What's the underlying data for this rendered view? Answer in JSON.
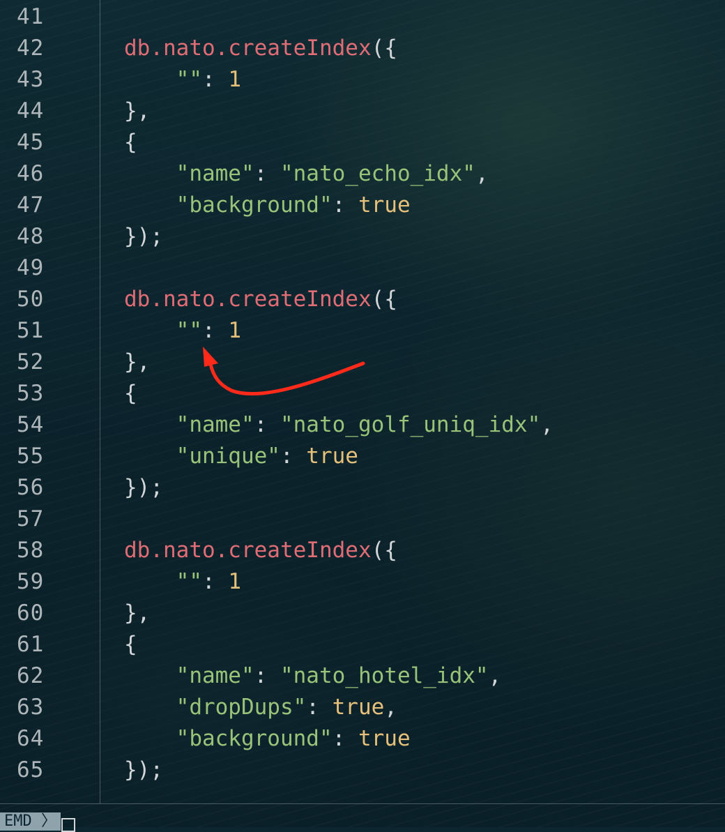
{
  "editor": {
    "lines": [
      {
        "number": "41",
        "indent": "",
        "tokens": []
      },
      {
        "number": "42",
        "indent": "",
        "tokens": [
          {
            "t": "db.nato.createIndex",
            "k": "fn"
          },
          {
            "t": "({",
            "k": "punc"
          }
        ]
      },
      {
        "number": "43",
        "indent": "    ",
        "tokens": [
          {
            "t": "\"\"",
            "k": "str"
          },
          {
            "t": ": ",
            "k": "punc"
          },
          {
            "t": "1",
            "k": "num"
          }
        ]
      },
      {
        "number": "44",
        "indent": "",
        "tokens": [
          {
            "t": "},",
            "k": "punc"
          }
        ]
      },
      {
        "number": "45",
        "indent": "",
        "tokens": [
          {
            "t": "{",
            "k": "punc"
          }
        ]
      },
      {
        "number": "46",
        "indent": "    ",
        "tokens": [
          {
            "t": "\"name\"",
            "k": "str"
          },
          {
            "t": ": ",
            "k": "punc"
          },
          {
            "t": "\"nato_echo_idx\"",
            "k": "str"
          },
          {
            "t": ",",
            "k": "punc"
          }
        ]
      },
      {
        "number": "47",
        "indent": "    ",
        "tokens": [
          {
            "t": "\"background\"",
            "k": "str"
          },
          {
            "t": ": ",
            "k": "punc"
          },
          {
            "t": "true",
            "k": "bool"
          }
        ]
      },
      {
        "number": "48",
        "indent": "",
        "tokens": [
          {
            "t": "});",
            "k": "punc"
          }
        ]
      },
      {
        "number": "49",
        "indent": "",
        "tokens": []
      },
      {
        "number": "50",
        "indent": "",
        "tokens": [
          {
            "t": "db.nato.createIndex",
            "k": "fn"
          },
          {
            "t": "({",
            "k": "punc"
          }
        ]
      },
      {
        "number": "51",
        "indent": "    ",
        "tokens": [
          {
            "t": "\"\"",
            "k": "str"
          },
          {
            "t": ": ",
            "k": "punc"
          },
          {
            "t": "1",
            "k": "num"
          }
        ]
      },
      {
        "number": "52",
        "indent": "",
        "tokens": [
          {
            "t": "},",
            "k": "punc"
          }
        ]
      },
      {
        "number": "53",
        "indent": "",
        "tokens": [
          {
            "t": "{",
            "k": "punc"
          }
        ]
      },
      {
        "number": "54",
        "indent": "    ",
        "tokens": [
          {
            "t": "\"name\"",
            "k": "str"
          },
          {
            "t": ": ",
            "k": "punc"
          },
          {
            "t": "\"nato_golf_uniq_idx\"",
            "k": "str"
          },
          {
            "t": ",",
            "k": "punc"
          }
        ]
      },
      {
        "number": "55",
        "indent": "    ",
        "tokens": [
          {
            "t": "\"unique\"",
            "k": "str"
          },
          {
            "t": ": ",
            "k": "punc"
          },
          {
            "t": "true",
            "k": "bool"
          }
        ]
      },
      {
        "number": "56",
        "indent": "",
        "tokens": [
          {
            "t": "});",
            "k": "punc"
          }
        ]
      },
      {
        "number": "57",
        "indent": "",
        "tokens": []
      },
      {
        "number": "58",
        "indent": "",
        "tokens": [
          {
            "t": "db.nato.createIndex",
            "k": "fn"
          },
          {
            "t": "({",
            "k": "punc"
          }
        ]
      },
      {
        "number": "59",
        "indent": "    ",
        "tokens": [
          {
            "t": "\"\"",
            "k": "str"
          },
          {
            "t": ": ",
            "k": "punc"
          },
          {
            "t": "1",
            "k": "num"
          }
        ]
      },
      {
        "number": "60",
        "indent": "",
        "tokens": [
          {
            "t": "},",
            "k": "punc"
          }
        ]
      },
      {
        "number": "61",
        "indent": "",
        "tokens": [
          {
            "t": "{",
            "k": "punc"
          }
        ]
      },
      {
        "number": "62",
        "indent": "    ",
        "tokens": [
          {
            "t": "\"name\"",
            "k": "str"
          },
          {
            "t": ": ",
            "k": "punc"
          },
          {
            "t": "\"nato_hotel_idx\"",
            "k": "str"
          },
          {
            "t": ",",
            "k": "punc"
          }
        ]
      },
      {
        "number": "63",
        "indent": "    ",
        "tokens": [
          {
            "t": "\"dropDups\"",
            "k": "str"
          },
          {
            "t": ": ",
            "k": "punc"
          },
          {
            "t": "true",
            "k": "bool"
          },
          {
            "t": ",",
            "k": "punc"
          }
        ]
      },
      {
        "number": "64",
        "indent": "    ",
        "tokens": [
          {
            "t": "\"background\"",
            "k": "str"
          },
          {
            "t": ": ",
            "k": "punc"
          },
          {
            "t": "true",
            "k": "bool"
          }
        ]
      },
      {
        "number": "65",
        "indent": "",
        "tokens": [
          {
            "t": "});",
            "k": "punc"
          }
        ]
      }
    ]
  },
  "status_bar": {
    "mode_label": "EMD 〉"
  },
  "colors": {
    "function": "#e06c75",
    "string": "#98c379",
    "number": "#e5c07b",
    "punctuation": "#d2d6d8",
    "line_number": "#aeb6ba",
    "annotation_arrow": "#ff2a1a"
  },
  "annotation": {
    "icon": "curved-arrow-icon",
    "points_to_line": "51"
  }
}
